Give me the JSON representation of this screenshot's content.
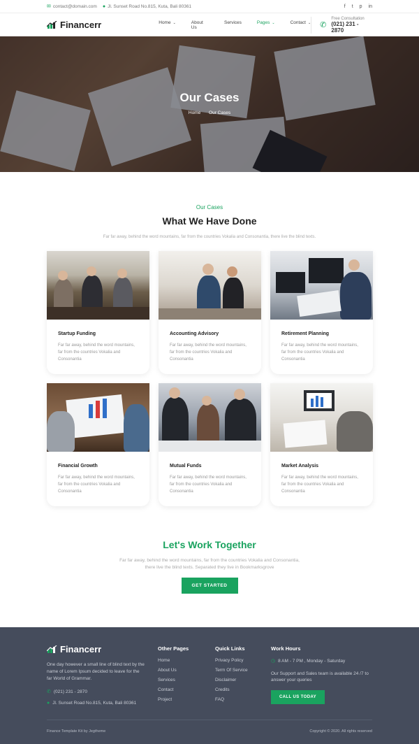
{
  "topbar": {
    "email": "contact@domain.com",
    "address": "Jl. Sunset Road No.815, Kuta, Bali 80361",
    "social": [
      "f",
      "t",
      "p",
      "in"
    ]
  },
  "header": {
    "logo": "Financerr",
    "nav": [
      {
        "label": "Home",
        "dropdown": true
      },
      {
        "label": "About Us",
        "dropdown": false
      },
      {
        "label": "Services",
        "dropdown": false
      },
      {
        "label": "Pages",
        "dropdown": true,
        "active": true
      },
      {
        "label": "Contact",
        "dropdown": true
      }
    ],
    "consult_label": "Free Consultation",
    "consult_phone": "(021) 231 - 2870"
  },
  "hero": {
    "title": "Our Cases",
    "breadcrumb": [
      "Home",
      "Our Cases"
    ]
  },
  "section": {
    "subtitle": "Our Cases",
    "title": "What We Have Done",
    "description": "Far far away, behind the word mountains, far from the countries Vokalia and Consonantia, there live the blind texts."
  },
  "cards": [
    {
      "title": "Startup Funding",
      "text": "Far far away, behind the word mountains, far from the countries Vokalia and Consonantia"
    },
    {
      "title": "Accounting Advisory",
      "text": "Far far away, behind the word mountains, far from the countries Vokalia and Consonantia"
    },
    {
      "title": "Retirement Planning",
      "text": "Far far away, behind the word mountains, far from the countries Vokalia and Consonantia"
    },
    {
      "title": "Financial Growth",
      "text": "Far far away, behind the word mountains, far from the countries Vokalia and Consonantia"
    },
    {
      "title": "Mutual Funds",
      "text": "Far far away, behind the word mountains, far from the countries Vokalia and Consonantia"
    },
    {
      "title": "Market Analysis",
      "text": "Far far away, behind the word mountains, far from the countries Vokalia and Consonantia"
    }
  ],
  "cta": {
    "title": "Let's Work Together",
    "line1": "Far far away, behind the word mountains, far from the countries Vokalia and Consonantia,",
    "line2": "there live the blind texts. Separated they live in Bookmarksgrove",
    "button": "GET STARTED"
  },
  "footer": {
    "logo": "Financerr",
    "description": "One day however a small line of blind text by the name of Lorem Ipsum decided to leave for the far World of Grammar.",
    "phone": "(021) 231 - 2870",
    "address": "Jl. Sunset Road No.815, Kuta, Bali 80361",
    "other_pages_title": "Other Pages",
    "other_pages": [
      "Home",
      "About Us",
      "Services",
      "Contact",
      "Project"
    ],
    "quick_links_title": "Quick Links",
    "quick_links": [
      "Privacy Policy",
      "Term Of Service",
      "Disclaimer",
      "Credits",
      "FAQ"
    ],
    "work_hours_title": "Work Hours",
    "hours": "8 AM - 7 PM , Monday - Saturday",
    "support": "Our Support and Sales team is available 24 /7 to answer your queries",
    "button": "CALL US TODAY",
    "credit": "Finance Template Kit by Jegtheme",
    "copyright": "Copyright © 2020. All rights reserved"
  },
  "colors": {
    "accent": "#1aa35f",
    "footer_bg": "#454c5c"
  }
}
